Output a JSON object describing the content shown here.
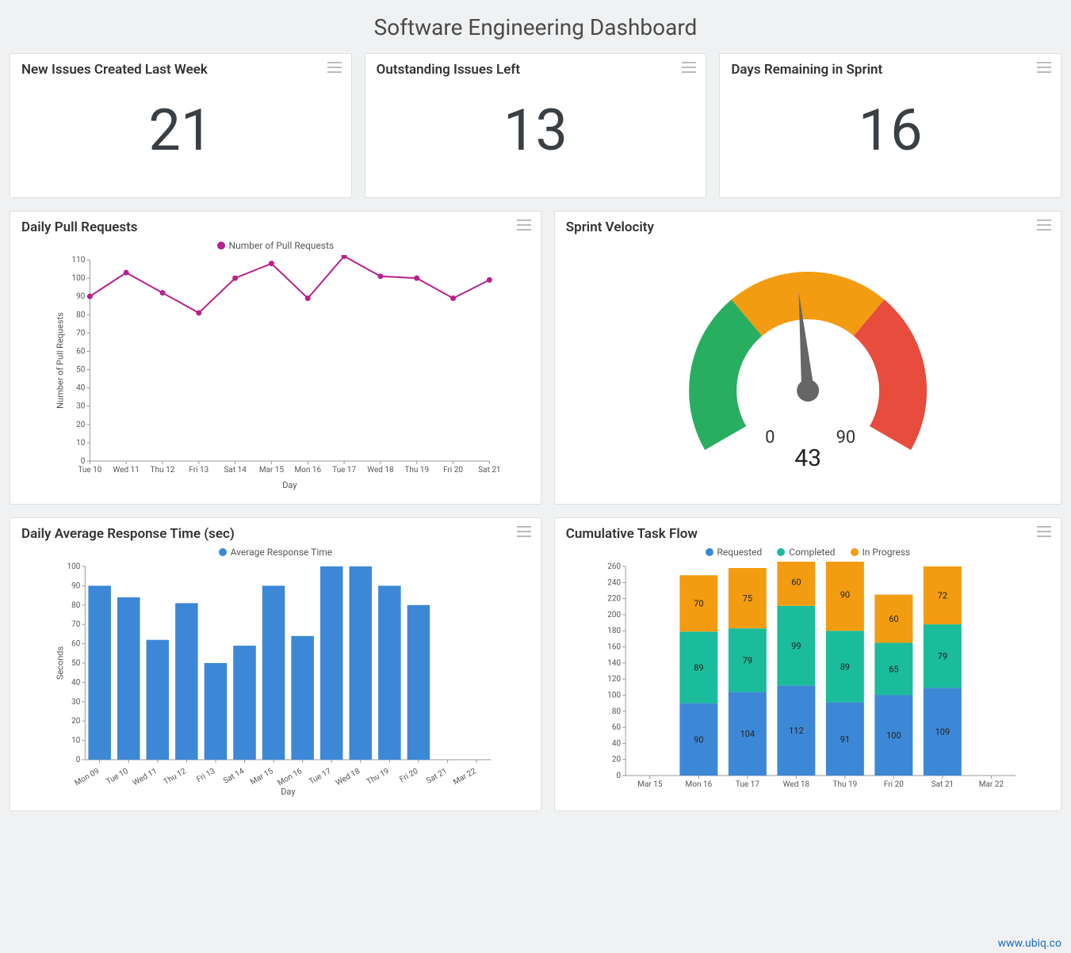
{
  "title": "Software Engineering Dashboard",
  "kpis": [
    {
      "label": "New Issues Created Last Week",
      "value": "21"
    },
    {
      "label": "Outstanding Issues Left",
      "value": "13"
    },
    {
      "label": "Days Remaining in Sprint",
      "value": "16"
    }
  ],
  "footer_link": "www.ubiq.co",
  "colors": {
    "magenta": "#b8208f",
    "blue": "#3d88d6",
    "teal": "#1abc9c",
    "orange": "#f39c12",
    "green": "#27ae60",
    "red": "#e74c3c",
    "grey": "#666"
  },
  "chart_data": [
    {
      "id": "daily_pull_requests",
      "type": "line",
      "title": "Daily Pull Requests",
      "legend": [
        "Number of Pull Requests"
      ],
      "xlabel": "Day",
      "ylabel": "Number of Pull Requests",
      "categories": [
        "Tue 10",
        "Wed 11",
        "Thu 12",
        "Fri 13",
        "Sat 14",
        "Mar 15",
        "Mon 16",
        "Tue 17",
        "Wed 18",
        "Thu 19",
        "Fri 20",
        "Sat 21"
      ],
      "series": [
        {
          "name": "Number of Pull Requests",
          "values": [
            90,
            103,
            92,
            81,
            100,
            108,
            89,
            112,
            101,
            100,
            89,
            99
          ]
        }
      ],
      "ylim": [
        0,
        110
      ],
      "ytick_step": 10
    },
    {
      "id": "sprint_velocity",
      "type": "gauge",
      "title": "Sprint Velocity",
      "min": 0,
      "max": 90,
      "value": 43,
      "zones": [
        {
          "from": 0,
          "to": 30,
          "color": "#27ae60"
        },
        {
          "from": 30,
          "to": 60,
          "color": "#f39c12"
        },
        {
          "from": 60,
          "to": 90,
          "color": "#e74c3c"
        }
      ]
    },
    {
      "id": "daily_avg_response_time",
      "type": "bar",
      "title": "Daily Average Response Time (sec)",
      "legend": [
        "Average Response Time"
      ],
      "xlabel": "Day",
      "ylabel": "Seconds",
      "categories": [
        "Mon 09",
        "Tue 10",
        "Wed 11",
        "Thu 12",
        "Fri 13",
        "Sat 14",
        "Mar 15",
        "Mon 16",
        "Tue 17",
        "Wed 18",
        "Thu 19",
        "Fri 20",
        "Sat 21",
        "Mar 22"
      ],
      "series": [
        {
          "name": "Average Response Time",
          "values": [
            90,
            84,
            62,
            81,
            50,
            59,
            90,
            64,
            101,
            100,
            90,
            80,
            null,
            null
          ]
        }
      ],
      "ylim": [
        0,
        100
      ],
      "ytick_step": 10
    },
    {
      "id": "cumulative_task_flow",
      "type": "stacked-bar",
      "title": "Cumulative Task Flow",
      "legend": [
        "Requested",
        "Completed",
        "In Progress"
      ],
      "xlabel": "",
      "ylabel": "",
      "categories": [
        "Mar 15",
        "Mon 16",
        "Tue 17",
        "Wed 18",
        "Thu 19",
        "Fri 20",
        "Sat 21",
        "Mar 22"
      ],
      "series": [
        {
          "name": "Requested",
          "color": "#3d88d6",
          "values": [
            null,
            90,
            104,
            112,
            91,
            100,
            109,
            null
          ]
        },
        {
          "name": "Completed",
          "color": "#1abc9c",
          "values": [
            null,
            89,
            79,
            99,
            89,
            65,
            79,
            null
          ]
        },
        {
          "name": "In Progress",
          "color": "#f39c12",
          "values": [
            null,
            70,
            75,
            60,
            90,
            60,
            72,
            null
          ]
        }
      ],
      "ylim": [
        0,
        260
      ],
      "ytick_step": 20
    }
  ]
}
